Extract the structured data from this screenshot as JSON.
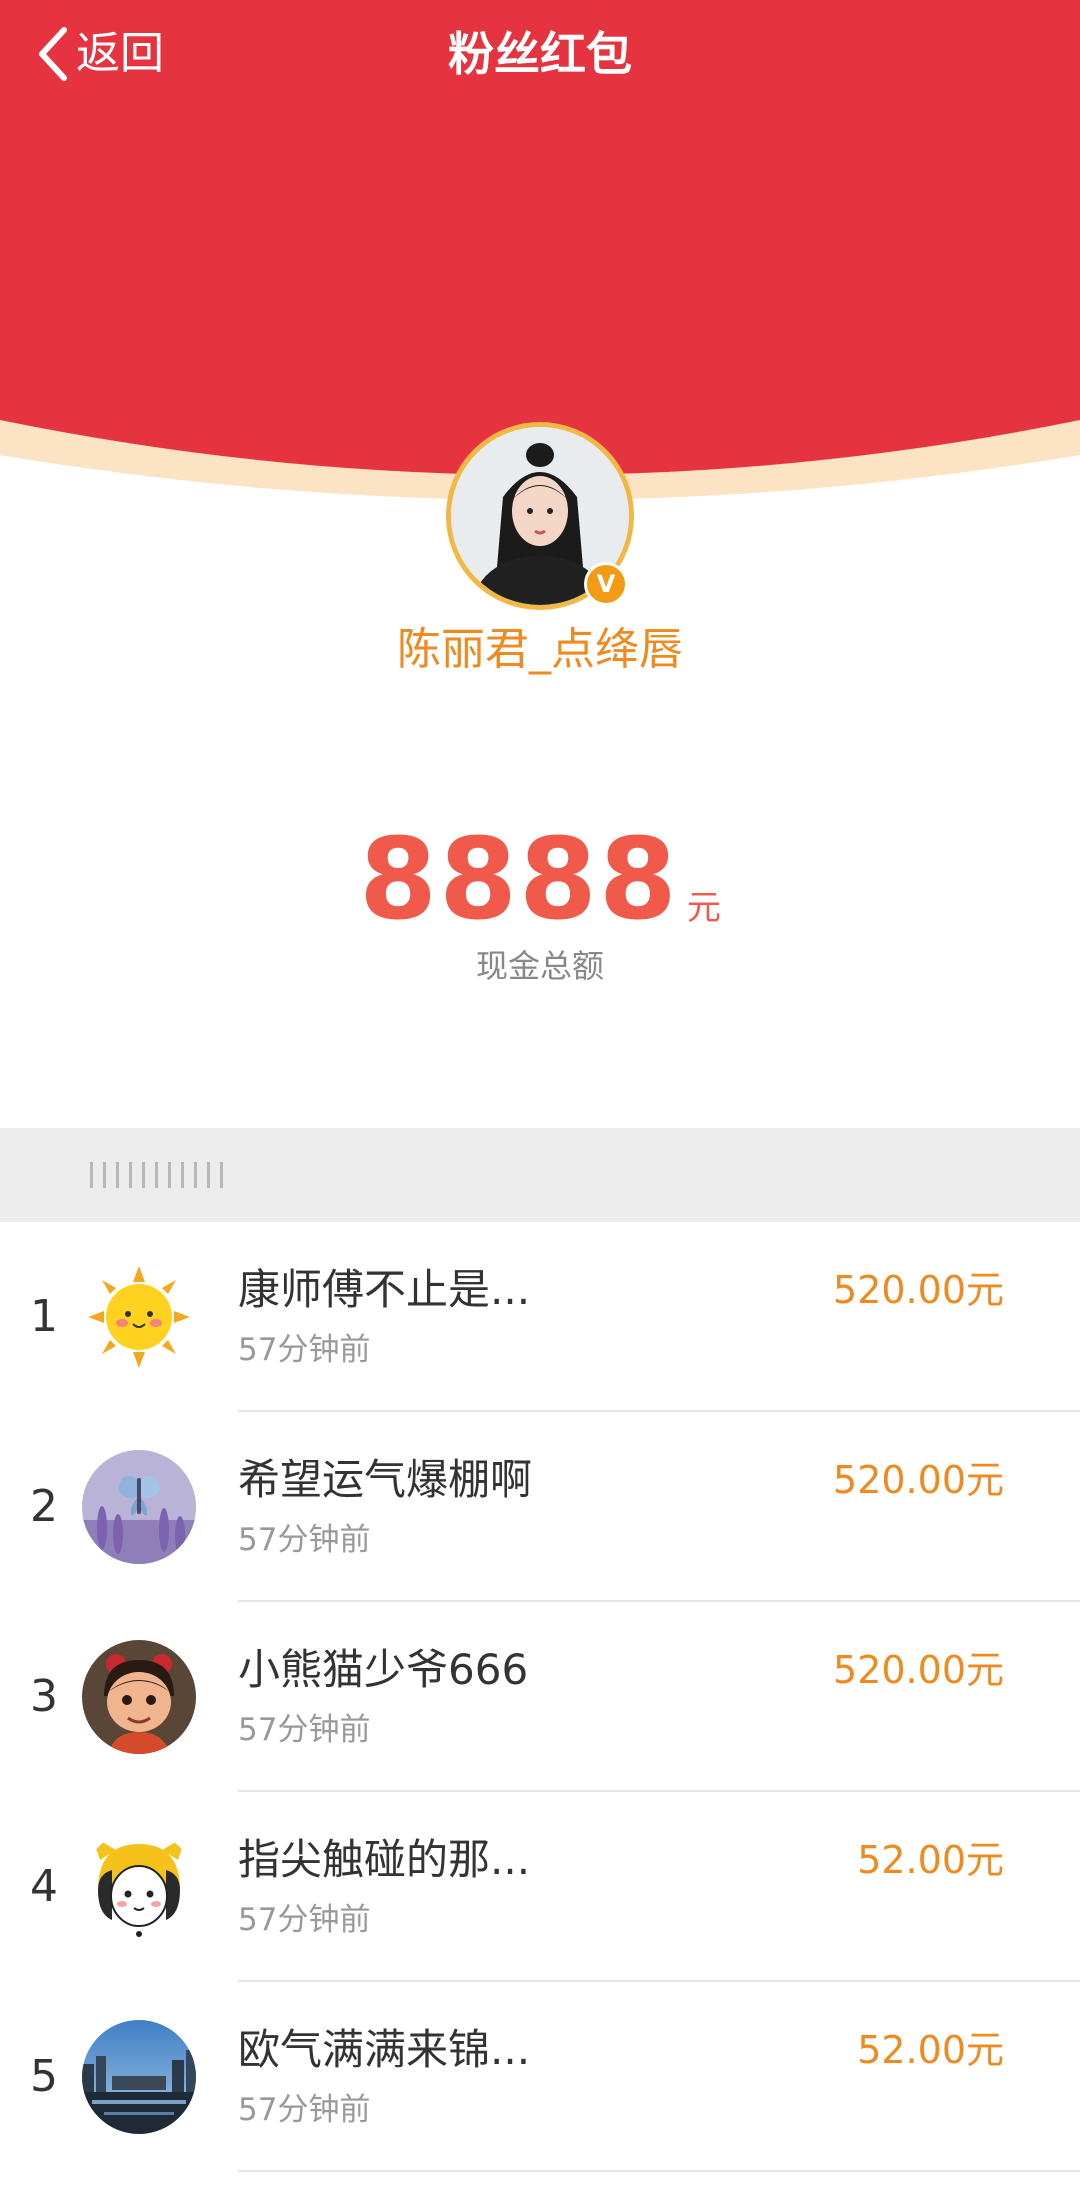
{
  "nav": {
    "back_label": "返回",
    "title": "粉丝红包"
  },
  "colors": {
    "header_red": "#e5333f",
    "header_rim": "#fbe3c4",
    "accent_orange": "#ee8a1f",
    "amount_red": "#f05a4a",
    "avatar_ring": "#f2b845",
    "verified_badge": "#f39b16"
  },
  "host": {
    "name": "陈丽君_点绛唇",
    "avatar_icon": "user-avatar-photo",
    "verified_icon": "verified-v-badge",
    "verified_mark": "V"
  },
  "summary": {
    "amount": "8888",
    "unit": "元",
    "caption": "现金总额"
  },
  "list": {
    "items": [
      {
        "rank": "1",
        "name": "康师傅不止是...",
        "time": "57分钟前",
        "amount": "520.00元",
        "avatar_icon": "sun-cartoon-avatar"
      },
      {
        "rank": "2",
        "name": "希望运气爆棚啊",
        "time": "57分钟前",
        "amount": "520.00元",
        "avatar_icon": "butterfly-lavender-avatar"
      },
      {
        "rank": "3",
        "name": "小熊猫少爷666",
        "time": "57分钟前",
        "amount": "520.00元",
        "avatar_icon": "cartoon-child-avatar"
      },
      {
        "rank": "4",
        "name": "指尖触碰的那...",
        "time": "57分钟前",
        "amount": "52.00元",
        "avatar_icon": "cartoon-girl-hat-avatar"
      },
      {
        "rank": "5",
        "name": "欧气满满来锦...",
        "time": "57分钟前",
        "amount": "52.00元",
        "avatar_icon": "night-city-avatar"
      }
    ]
  }
}
